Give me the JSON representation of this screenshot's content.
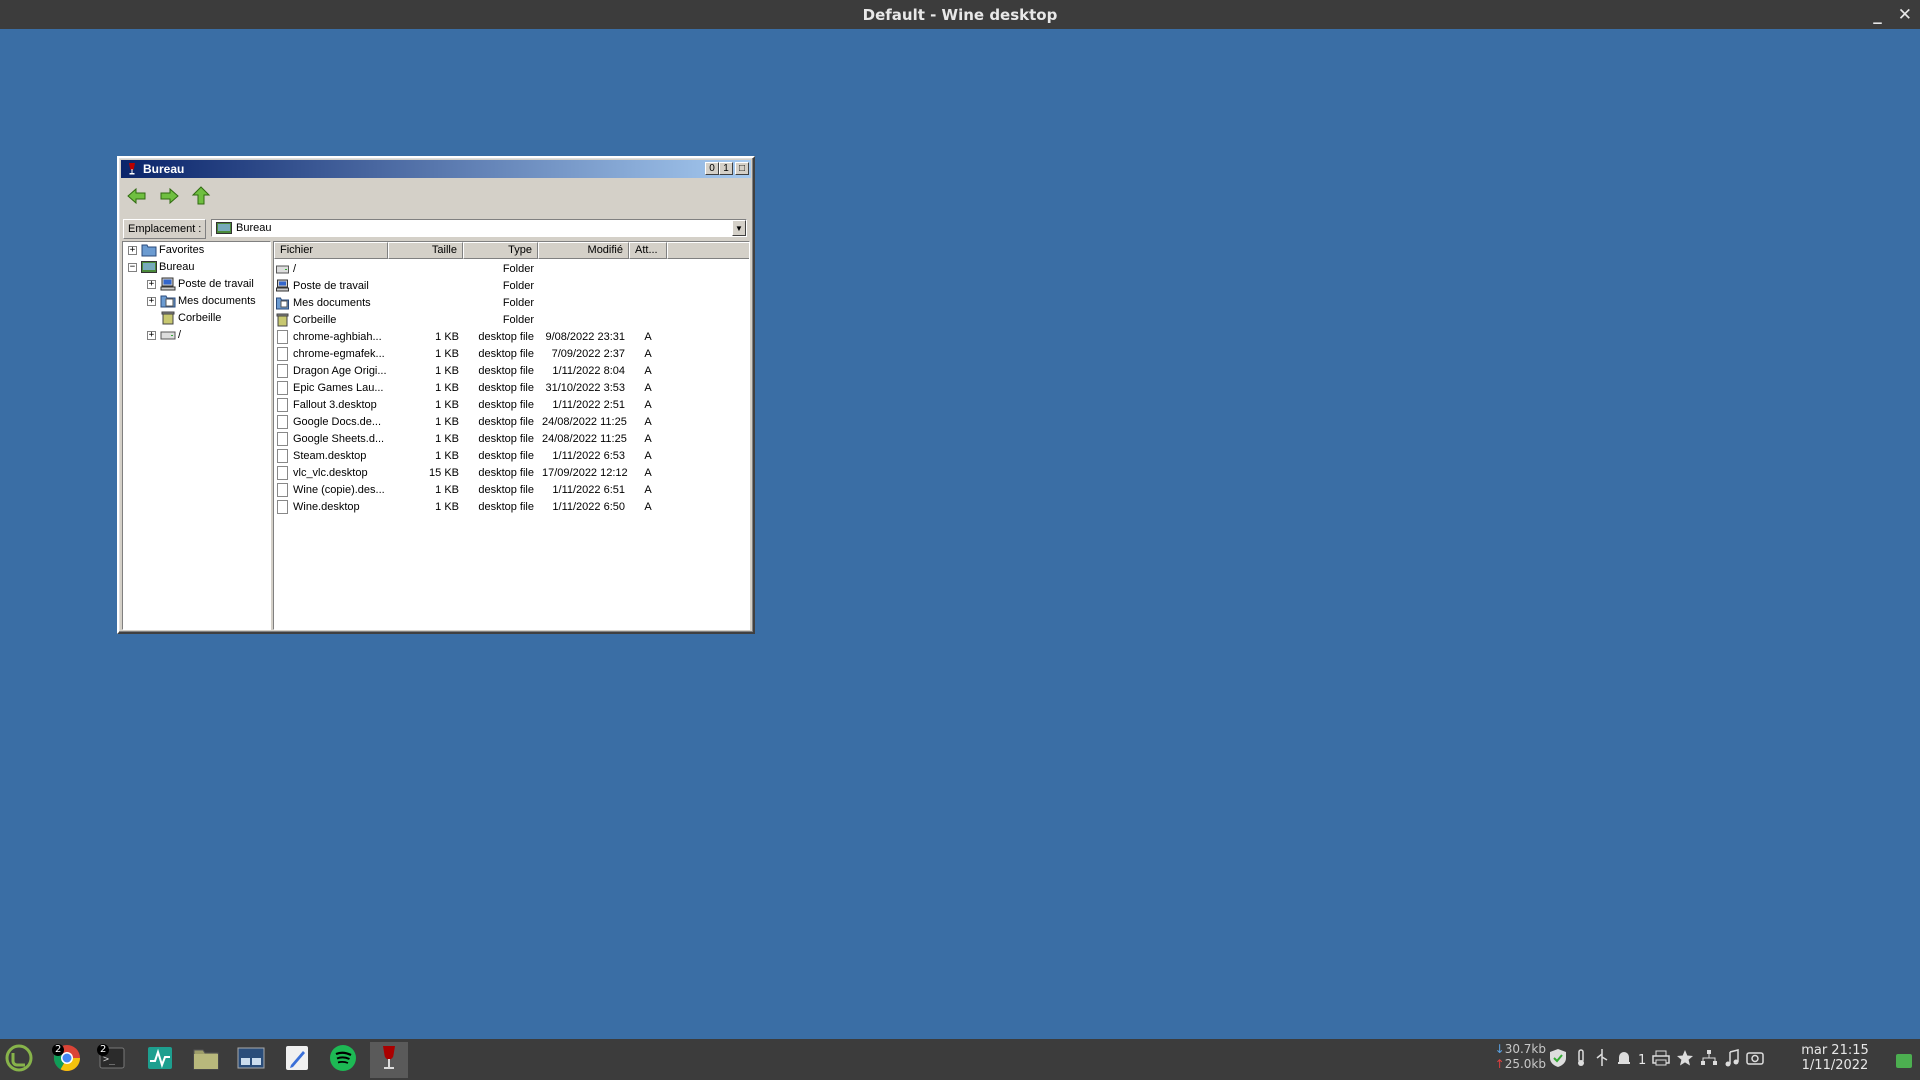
{
  "host": {
    "title": "Default - Wine desktop",
    "minimize_label": "_",
    "close_label": "✕"
  },
  "window": {
    "title": "Bureau",
    "minimize_label": "0",
    "maximize_label": "1",
    "close_label": "□"
  },
  "toolbar": {
    "back_icon": "back-arrow-icon",
    "forward_icon": "forward-arrow-icon",
    "up_icon": "up-arrow-icon"
  },
  "location": {
    "label": "Emplacement :",
    "value": "Bureau"
  },
  "tree": {
    "items": [
      {
        "label": "Favorites",
        "expander": "+"
      },
      {
        "label": "Bureau",
        "expander": "−"
      },
      {
        "label": "Poste de travail",
        "expander": "+"
      },
      {
        "label": "Mes documents",
        "expander": "+"
      },
      {
        "label": "Corbeille",
        "expander": ""
      },
      {
        "label": "/",
        "expander": "+"
      }
    ]
  },
  "list": {
    "columns": [
      "Fichier",
      "Taille",
      "Type",
      "Modifié",
      "Att..."
    ],
    "rows": [
      {
        "name": "/",
        "size": "",
        "type": "Folder",
        "modified": "",
        "attr": "",
        "icon": "drive-icon"
      },
      {
        "name": "Poste de travail",
        "size": "",
        "type": "Folder",
        "modified": "",
        "attr": "",
        "icon": "computer-icon"
      },
      {
        "name": "Mes documents",
        "size": "",
        "type": "Folder",
        "modified": "",
        "attr": "",
        "icon": "documents-icon"
      },
      {
        "name": "Corbeille",
        "size": "",
        "type": "Folder",
        "modified": "",
        "attr": "",
        "icon": "trash-icon"
      },
      {
        "name": "chrome-aghbiah...",
        "size": "1 KB",
        "type": "desktop file",
        "modified": "9/08/2022 23:31",
        "attr": "A",
        "icon": "file-icon"
      },
      {
        "name": "chrome-egmafek...",
        "size": "1 KB",
        "type": "desktop file",
        "modified": "7/09/2022 2:37",
        "attr": "A",
        "icon": "file-icon"
      },
      {
        "name": "Dragon Age Origi...",
        "size": "1 KB",
        "type": "desktop file",
        "modified": "1/11/2022 8:04",
        "attr": "A",
        "icon": "file-icon"
      },
      {
        "name": "Epic Games Lau...",
        "size": "1 KB",
        "type": "desktop file",
        "modified": "31/10/2022 3:53",
        "attr": "A",
        "icon": "file-icon"
      },
      {
        "name": "Fallout 3.desktop",
        "size": "1 KB",
        "type": "desktop file",
        "modified": "1/11/2022 2:51",
        "attr": "A",
        "icon": "file-icon"
      },
      {
        "name": "Google Docs.de...",
        "size": "1 KB",
        "type": "desktop file",
        "modified": "24/08/2022 11:25",
        "attr": "A",
        "icon": "file-icon"
      },
      {
        "name": "Google Sheets.d...",
        "size": "1 KB",
        "type": "desktop file",
        "modified": "24/08/2022 11:25",
        "attr": "A",
        "icon": "file-icon"
      },
      {
        "name": "Steam.desktop",
        "size": "1 KB",
        "type": "desktop file",
        "modified": "1/11/2022 6:53",
        "attr": "A",
        "icon": "file-icon"
      },
      {
        "name": "vlc_vlc.desktop",
        "size": "15 KB",
        "type": "desktop file",
        "modified": "17/09/2022 12:12",
        "attr": "A",
        "icon": "file-icon"
      },
      {
        "name": "Wine (copie).des...",
        "size": "1 KB",
        "type": "desktop file",
        "modified": "1/11/2022 6:51",
        "attr": "A",
        "icon": "file-icon"
      },
      {
        "name": "Wine.desktop",
        "size": "1 KB",
        "type": "desktop file",
        "modified": "1/11/2022 6:50",
        "attr": "A",
        "icon": "file-icon"
      }
    ]
  },
  "taskbar": {
    "items": [
      {
        "name": "mint-menu-icon",
        "badge": ""
      },
      {
        "name": "chrome-icon",
        "badge": "2"
      },
      {
        "name": "terminal-icon",
        "badge": "2"
      },
      {
        "name": "system-monitor-icon",
        "badge": ""
      },
      {
        "name": "files-icon",
        "badge": ""
      },
      {
        "name": "workspace-switcher-icon",
        "badge": ""
      },
      {
        "name": "text-editor-icon",
        "badge": ""
      },
      {
        "name": "spotify-icon",
        "badge": ""
      },
      {
        "name": "wine-icon",
        "badge": ""
      }
    ],
    "net_down": "30.7kb",
    "net_up": "25.0kb",
    "notif_count": "1",
    "clock_time": "mar 21:15",
    "clock_date": "1/11/2022"
  },
  "colors": {
    "desktop": "#3a6ea5",
    "titlebar_start": "#0a246a",
    "titlebar_end": "#a6caf0",
    "taskbar": "#3c3c3c"
  }
}
